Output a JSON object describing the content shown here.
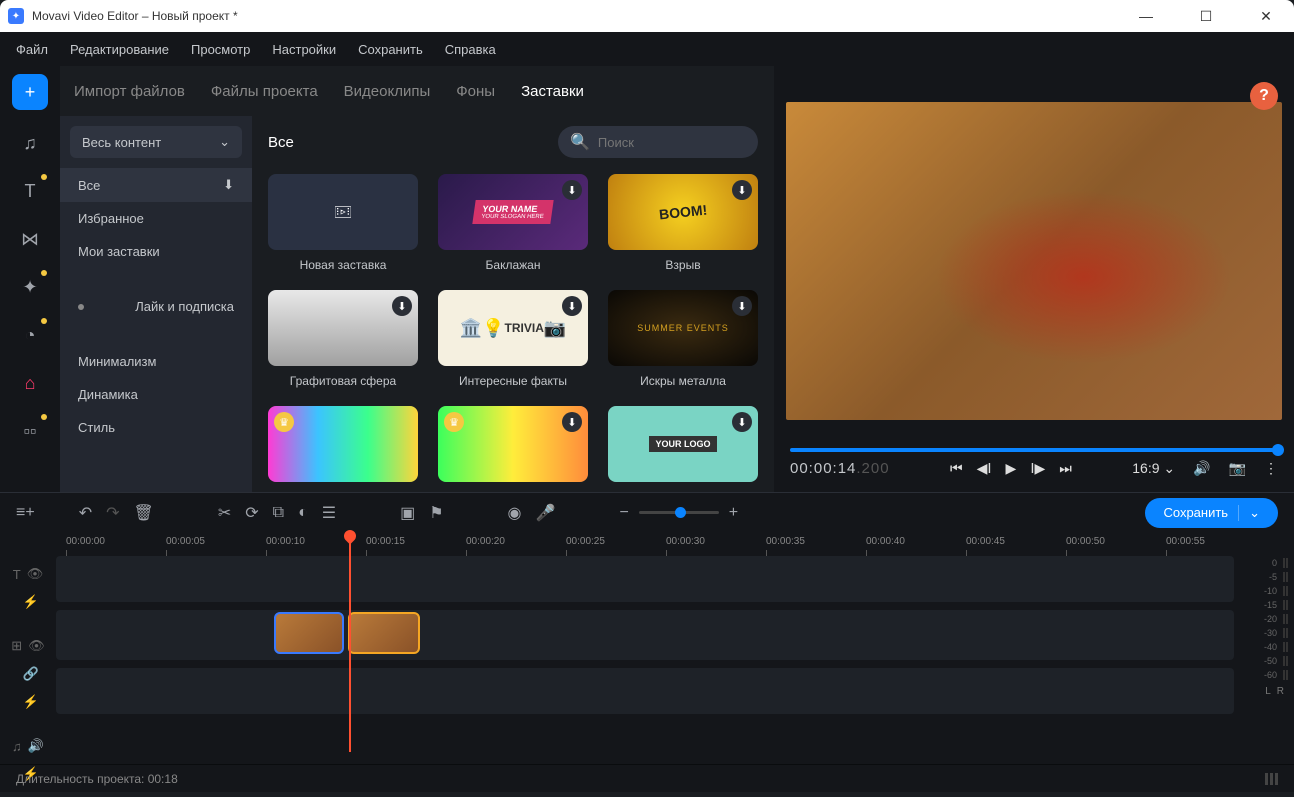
{
  "titlebar": {
    "title": "Movavi Video Editor – Новый проект *"
  },
  "menubar": {
    "items": [
      "Файл",
      "Редактирование",
      "Просмотр",
      "Настройки",
      "Сохранить",
      "Справка"
    ]
  },
  "tabs": {
    "items": [
      "Импорт файлов",
      "Файлы проекта",
      "Видеоклипы",
      "Фоны",
      "Заставки"
    ],
    "active_index": 4
  },
  "filter": {
    "dropdown": "Весь контент",
    "items_top": [
      "Все",
      "Избранное",
      "Мои заставки"
    ],
    "items_mid": [
      "Лайк и подписка"
    ],
    "items_bot": [
      "Минимализм",
      "Динамика",
      "Стиль"
    ],
    "active": "Все"
  },
  "gallery": {
    "heading": "Все",
    "search_placeholder": "Поиск",
    "items": [
      {
        "label": "Новая заставка"
      },
      {
        "label": "Баклажан"
      },
      {
        "label": "Взрыв"
      },
      {
        "label": "Графитовая сфера"
      },
      {
        "label": "Интересные факты"
      },
      {
        "label": "Искры металла"
      }
    ],
    "thumb_text": {
      "t1": "YOUR NAME",
      "t1b": "YOUR SLOGAN HERE",
      "t2": "BOOM!",
      "t4": "TRIVIA",
      "t5": "SUMMER EVENTS",
      "t8": "YOUR LOGO"
    }
  },
  "preview": {
    "help": "?",
    "time": "00:00:14",
    "time_ms": ".200",
    "aspect": "16:9"
  },
  "timeline_toolbar": {
    "save": "Сохранить"
  },
  "ruler": {
    "marks": [
      "00:00:00",
      "00:00:05",
      "00:00:10",
      "00:00:15",
      "00:00:20",
      "00:00:25",
      "00:00:30",
      "00:00:35",
      "00:00:40",
      "00:00:45",
      "00:00:50",
      "00:00:55"
    ]
  },
  "meters": {
    "levels": [
      "0",
      "-5",
      "-10",
      "-15",
      "-20",
      "-30",
      "-40",
      "-50",
      "-60"
    ],
    "lr": [
      "L",
      "R"
    ]
  },
  "statusbar": {
    "text": "Длительность проекта: 00:18"
  }
}
